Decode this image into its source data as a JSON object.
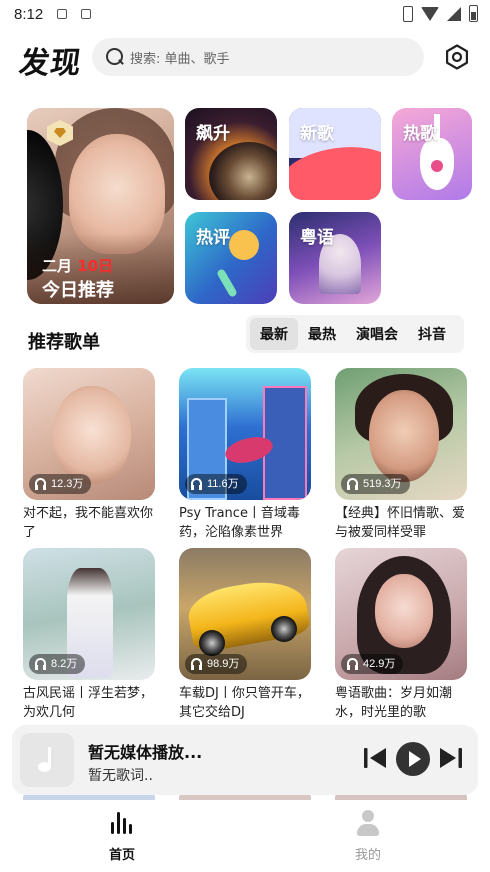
{
  "status_bar": {
    "time": "8:12"
  },
  "header": {
    "title": "发现",
    "search_placeholder": "搜索: 单曲、歌手"
  },
  "featured": {
    "month": "二月",
    "day": "10日",
    "label": "今日推荐"
  },
  "categories": [
    {
      "label": "飙升"
    },
    {
      "label": "新歌"
    },
    {
      "label": "热歌"
    },
    {
      "label": "热评"
    },
    {
      "label": "粤语"
    }
  ],
  "section": {
    "title": "推荐歌单",
    "tabs": [
      {
        "label": "最新"
      },
      {
        "label": "最热"
      },
      {
        "label": "演唱会"
      },
      {
        "label": "抖音"
      }
    ]
  },
  "playlists": [
    {
      "count": "12.3万",
      "title": "对不起，我不能喜欢你了"
    },
    {
      "count": "11.6万",
      "title": "Psy Trance丨音域毒药，沦陷像素世界"
    },
    {
      "count": "519.3万",
      "title": "【经典】怀旧情歌、爱与被爱同样受罪"
    },
    {
      "count": "8.2万",
      "title": "古风民谣丨浮生若梦，为欢几何"
    },
    {
      "count": "98.9万",
      "title": "车载DJ丨你只管开车，其它交给DJ"
    },
    {
      "count": "42.9万",
      "title": "粤语歌曲：岁月如潮水，时光里的歌"
    }
  ],
  "player": {
    "title": "暂无媒体播放...",
    "lyric": "暂无歌词.."
  },
  "bottom_nav": [
    {
      "label": "首页",
      "icon": "wave-icon",
      "active": true
    },
    {
      "label": "我的",
      "icon": "user-icon",
      "active": false
    }
  ],
  "colors": {
    "accent_red": "#ff2a2a",
    "text": "#111111",
    "muted": "#999999"
  }
}
